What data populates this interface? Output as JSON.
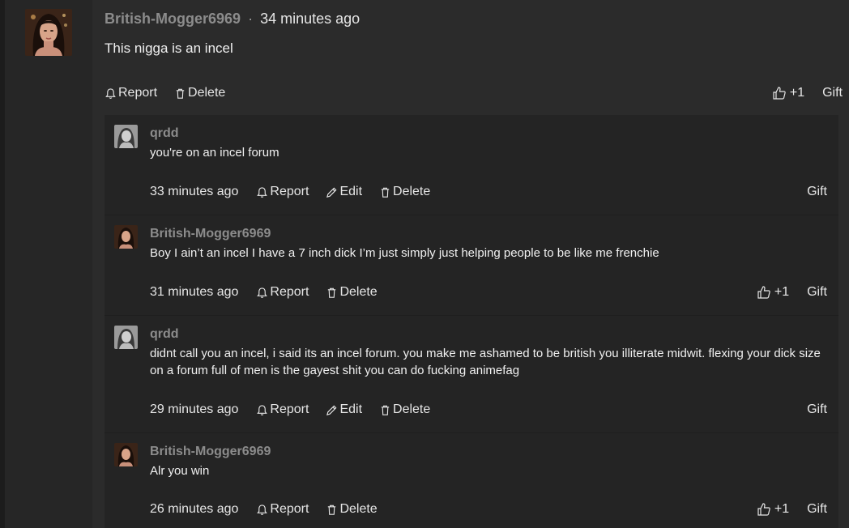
{
  "post": {
    "author": "British-Mogger6969",
    "separator": "·",
    "time": "34 minutes ago",
    "text": "This nigga is an incel",
    "actions": {
      "report": "Report",
      "delete": "Delete"
    },
    "likes": "+1",
    "gift": "Gift"
  },
  "replies": [
    {
      "author": "qrdd",
      "text": "you're on an incel forum",
      "time": "33 minutes ago",
      "report": "Report",
      "edit": "Edit",
      "delete": "Delete",
      "gift": "Gift"
    },
    {
      "author": "British-Mogger6969",
      "text": "Boy I ain’t an incel I have a 7 inch dick I’m just simply just helping people to be like me frenchie",
      "time": "31 minutes ago",
      "report": "Report",
      "delete": "Delete",
      "likes": "+1",
      "gift": "Gift"
    },
    {
      "author": "qrdd",
      "text": "didnt call you an incel, i said its an incel forum. you make me ashamed to be british you illiterate midwit. flexing your dick size on a forum full of men is the gayest shit you can do fucking animefag",
      "time": "29 minutes ago",
      "report": "Report",
      "edit": "Edit",
      "delete": "Delete",
      "gift": "Gift"
    },
    {
      "author": "British-Mogger6969",
      "text": "Alr you win",
      "time": "26 minutes ago",
      "report": "Report",
      "delete": "Delete",
      "likes": "+1",
      "gift": "Gift"
    }
  ],
  "icons": {
    "report": "bell-icon",
    "edit": "pencil-icon",
    "delete": "trash-icon",
    "like": "thumbs-up-icon"
  }
}
